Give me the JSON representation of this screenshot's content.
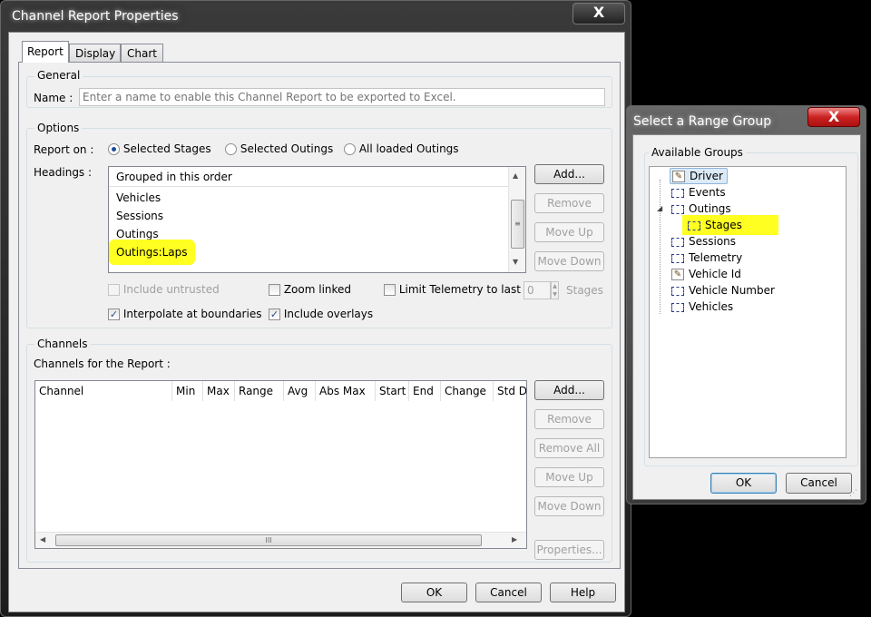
{
  "main_dialog": {
    "title": "Channel Report Properties",
    "close_label": "X",
    "tabs": [
      {
        "label": "Report",
        "active": true
      },
      {
        "label": "Display",
        "active": false
      },
      {
        "label": "Chart",
        "active": false
      }
    ],
    "general": {
      "group_label": "General",
      "name_label": "Name :",
      "name_value": "",
      "name_placeholder": "Enter a name to enable this Channel Report to be exported to Excel."
    },
    "options": {
      "group_label": "Options",
      "report_on_label": "Report on :",
      "report_on_options": [
        {
          "label": "Selected Stages",
          "selected": true
        },
        {
          "label": "Selected Outings",
          "selected": false
        },
        {
          "label": "All loaded Outings",
          "selected": false
        }
      ],
      "headings_label": "Headings :",
      "headings_header": "Grouped in this order",
      "headings_items": [
        "Vehicles",
        "Sessions",
        "Outings",
        "Outings:Laps"
      ],
      "highlighted_item": "Outings:Laps",
      "buttons": {
        "add": "Add...",
        "remove": "Remove",
        "move_up": "Move Up",
        "move_down": "Move Down"
      },
      "include_untrusted": {
        "label": "Include untrusted",
        "checked": false,
        "disabled": true
      },
      "zoom_linked": {
        "label": "Zoom linked",
        "checked": false
      },
      "limit_telemetry": {
        "label": "Limit Telemetry to last",
        "checked": false,
        "value": "0",
        "unit": "Stages"
      },
      "interpolate": {
        "label": "Interpolate at boundaries",
        "checked": true
      },
      "include_overlays": {
        "label": "Include overlays",
        "checked": true
      }
    },
    "channels": {
      "group_label": "Channels",
      "list_label": "Channels for the Report :",
      "columns": [
        "Channel",
        "Min",
        "Max",
        "Range",
        "Avg",
        "Abs Max",
        "Start",
        "End",
        "Change",
        "Std D"
      ],
      "rows": [],
      "hscroll_grip": "III",
      "buttons": {
        "add": "Add...",
        "remove": "Remove",
        "remove_all": "Remove All",
        "move_up": "Move Up",
        "move_down": "Move Down",
        "properties": "Properties..."
      }
    },
    "footer": {
      "ok": "OK",
      "cancel": "Cancel",
      "help": "Help"
    }
  },
  "range_dialog": {
    "title": "Select a Range Group",
    "close_label": "X",
    "group_label": "Available Groups",
    "tree": [
      {
        "label": "Driver",
        "icon": "edit-icon",
        "level": 0,
        "selected": true
      },
      {
        "label": "Events",
        "icon": "range-icon",
        "level": 0
      },
      {
        "label": "Outings",
        "icon": "range-icon",
        "level": 0,
        "expanded": true
      },
      {
        "label": "Stages",
        "icon": "range-icon",
        "level": 1,
        "highlighted": true
      },
      {
        "label": "Sessions",
        "icon": "range-icon",
        "level": 0
      },
      {
        "label": "Telemetry",
        "icon": "range-icon",
        "level": 0
      },
      {
        "label": "Vehicle Id",
        "icon": "edit-icon",
        "level": 0
      },
      {
        "label": "Vehicle Number",
        "icon": "range-icon",
        "level": 0
      },
      {
        "label": "Vehicles",
        "icon": "range-icon",
        "level": 0
      }
    ],
    "ok": "OK",
    "cancel": "Cancel"
  },
  "colors": {
    "highlight": "#ffff22",
    "frame": "#1c1c1c",
    "client": "#f0f0f0"
  }
}
